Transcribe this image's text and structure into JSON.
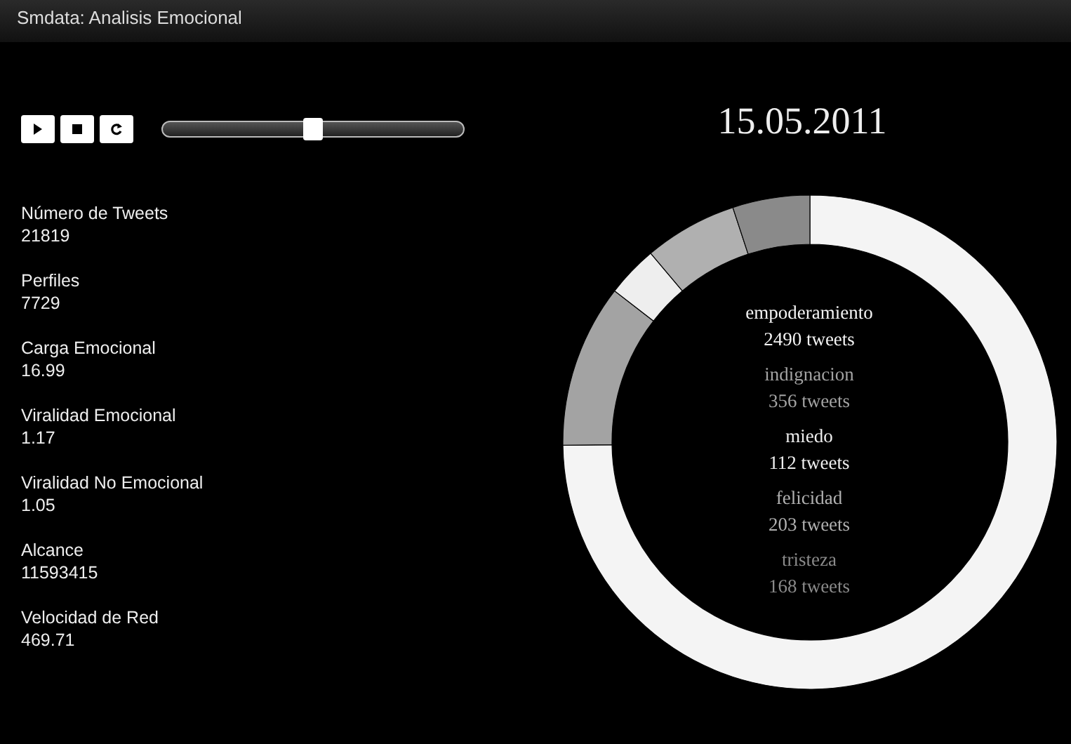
{
  "window": {
    "title": "Smdata: Analisis Emocional"
  },
  "controls": {
    "buttons": [
      {
        "kind": "play"
      },
      {
        "kind": "stop"
      },
      {
        "kind": "reload"
      }
    ],
    "slider": {
      "level": 0.5
    }
  },
  "date": "15.05.2011",
  "stats": [
    {
      "label": "Número de Tweets",
      "value": "21819"
    },
    {
      "label": "Perfiles",
      "value": "7729"
    },
    {
      "label": "Carga Emocional",
      "value": "16.99"
    },
    {
      "label": "Viralidad Emocional",
      "value": "1.17"
    },
    {
      "label": "Viralidad No Emocional",
      "value": "1.05"
    },
    {
      "label": "Alcance",
      "value": "11593415"
    },
    {
      "label": "Velocidad de Red",
      "value": "469.71"
    }
  ],
  "emotions": [
    {
      "name": "empoderamiento",
      "tweets": "2490 tweets",
      "color": "#f4f4f4"
    },
    {
      "name": "indignacion",
      "tweets": "356 tweets",
      "color": "#a3a3a3"
    },
    {
      "name": "miedo",
      "tweets": "112 tweets",
      "color": "#eeeeee"
    },
    {
      "name": "felicidad",
      "tweets": "203 tweets",
      "color": "#b0b0b0"
    },
    {
      "name": "tristeza",
      "tweets": "168 tweets",
      "color": "#8a8a8a"
    }
  ],
  "chart_data": {
    "type": "donut",
    "values": [
      74.8,
      10.69,
      3.36,
      6.1,
      5.05
    ]
  }
}
